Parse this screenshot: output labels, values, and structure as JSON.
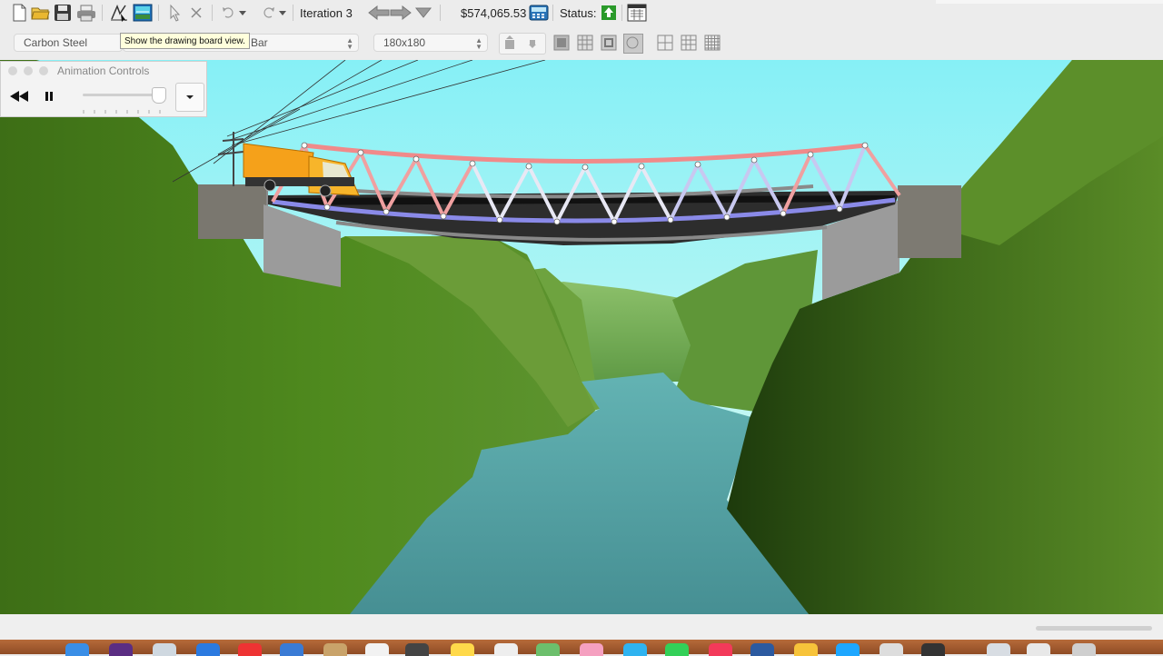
{
  "toolbar": {
    "iteration_label": "Iteration 3",
    "cost_label": "$574,065.53",
    "status_label": "Status:",
    "buttons": [
      "new-document",
      "open",
      "save",
      "print",
      "drawing-board",
      "animation-view",
      "select",
      "delete",
      "undo",
      "redo",
      "back",
      "forward",
      "iteration-menu",
      "cost-report",
      "status-ok",
      "load-test-results"
    ]
  },
  "tooltip": {
    "text": "Show the drawing board view."
  },
  "properties": {
    "material": "Carbon Steel",
    "cross_section": "d Bar",
    "size": "180x180"
  },
  "animation_controls": {
    "title": "Animation Controls",
    "rewind_icon": "rewind-icon",
    "pause_icon": "pause-icon",
    "speed_level": 0.9,
    "menu_icon": "dropdown-icon"
  },
  "scene": {
    "sky_color": "#8ff0f3",
    "river_color": "#4d9a9a",
    "tension_color": "#f08a8a",
    "compression_color": "#8a8ae8"
  },
  "colors": {
    "status_ok": "#2a9a2a",
    "truck": "#f5a11a"
  }
}
